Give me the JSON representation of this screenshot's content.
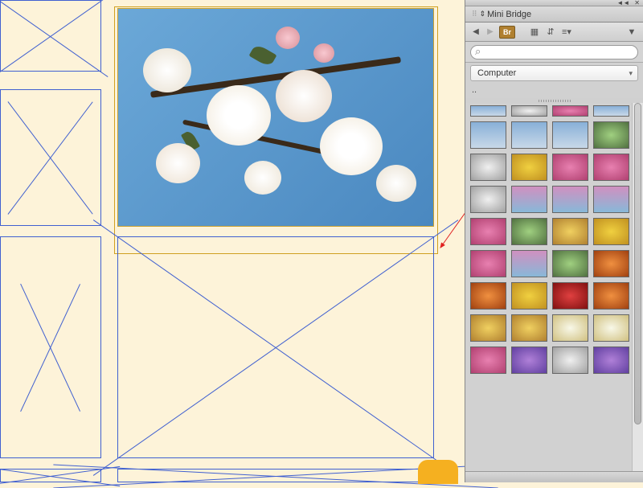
{
  "panel": {
    "title": "Mini Bridge",
    "search_placeholder": "",
    "breadcrumb": "Computer",
    "parent": "..",
    "br_label": "Br",
    "collapse": "◄◄",
    "close": "✕"
  },
  "thumbnails": [
    {
      "cls": "t-blossom partial"
    },
    {
      "cls": "t-white partial"
    },
    {
      "cls": "t-pink partial"
    },
    {
      "cls": "t-blossom partial"
    },
    {
      "cls": "t-blossom"
    },
    {
      "cls": "t-blossom"
    },
    {
      "cls": "t-blossom"
    },
    {
      "cls": "t-green"
    },
    {
      "cls": "t-white"
    },
    {
      "cls": "t-yellow"
    },
    {
      "cls": "t-pink"
    },
    {
      "cls": "t-pink"
    },
    {
      "cls": "t-white"
    },
    {
      "cls": "t-foxglove"
    },
    {
      "cls": "t-foxglove"
    },
    {
      "cls": "t-foxglove"
    },
    {
      "cls": "t-pink"
    },
    {
      "cls": "t-green"
    },
    {
      "cls": "t-rose"
    },
    {
      "cls": "t-yellow"
    },
    {
      "cls": "t-pink"
    },
    {
      "cls": "t-foxglove"
    },
    {
      "cls": "t-green"
    },
    {
      "cls": "t-orange"
    },
    {
      "cls": "t-orange"
    },
    {
      "cls": "t-yellow"
    },
    {
      "cls": "t-red"
    },
    {
      "cls": "t-orange"
    },
    {
      "cls": "t-rose"
    },
    {
      "cls": "t-rose"
    },
    {
      "cls": "t-daisy"
    },
    {
      "cls": "t-daisy"
    },
    {
      "cls": "t-pink"
    },
    {
      "cls": "t-purple"
    },
    {
      "cls": "t-white"
    },
    {
      "cls": "t-purple"
    }
  ]
}
